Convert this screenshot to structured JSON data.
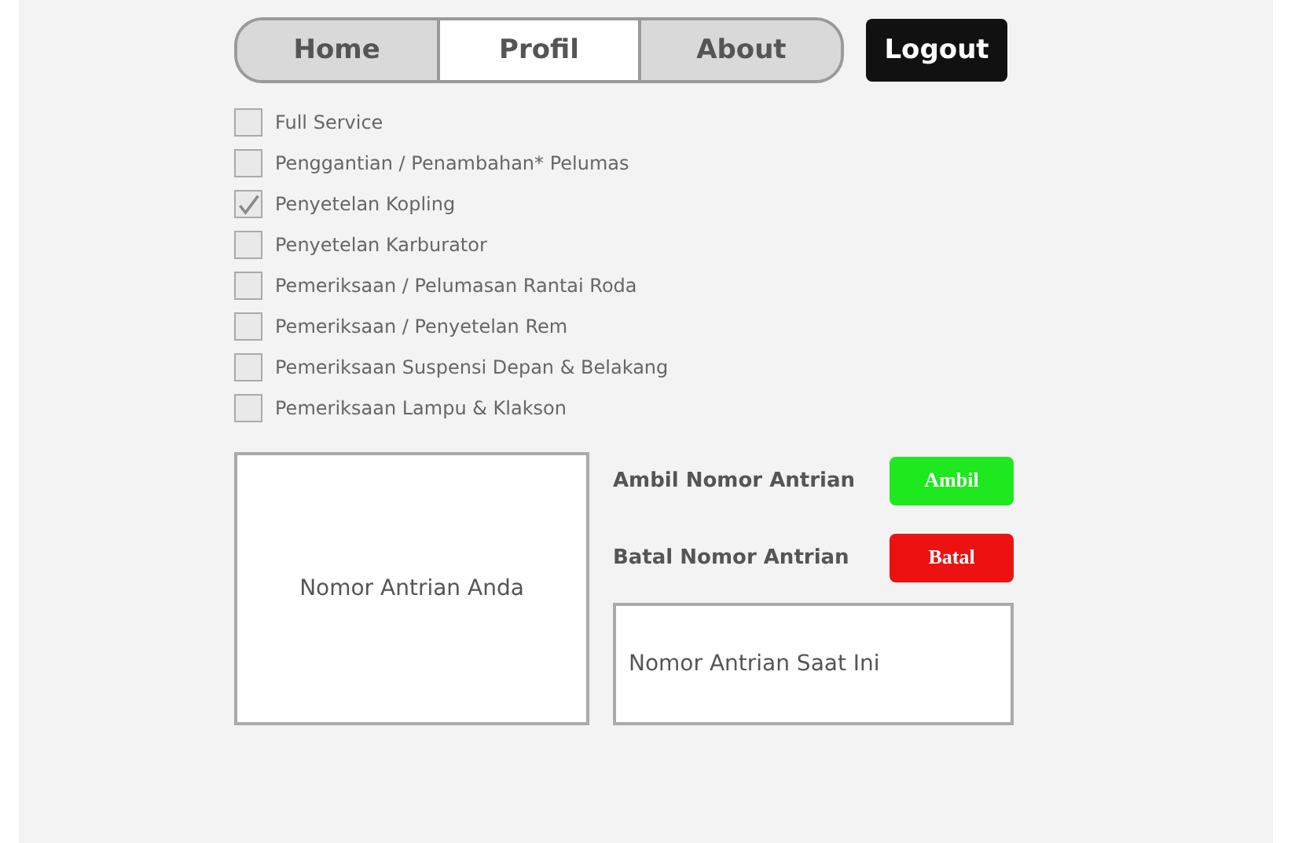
{
  "nav": {
    "tabs": [
      {
        "label": "Home",
        "selected": false
      },
      {
        "label": "Profil",
        "selected": true
      },
      {
        "label": "About",
        "selected": false
      }
    ],
    "logout": "Logout"
  },
  "services": [
    {
      "label": "Full Service",
      "checked": false
    },
    {
      "label": "Penggantian / Penambahan* Pelumas",
      "checked": false
    },
    {
      "label": "Penyetelan Kopling",
      "checked": true
    },
    {
      "label": "Penyetelan Karburator",
      "checked": false
    },
    {
      "label": "Pemeriksaan / Pelumasan Rantai Roda",
      "checked": false
    },
    {
      "label": "Pemeriksaan / Penyetelan Rem",
      "checked": false
    },
    {
      "label": "Pemeriksaan Suspensi Depan & Belakang",
      "checked": false
    },
    {
      "label": "Pemeriksaan Lampu & Klakson",
      "checked": false
    }
  ],
  "queue": {
    "your_number": "Nomor Antrian Anda",
    "actions": [
      {
        "kind": "take",
        "label": "Ambil Nomor Antrian",
        "button": "Ambil"
      },
      {
        "kind": "cancel",
        "label": "Batal Nomor Antrian",
        "button": "Batal"
      }
    ],
    "current_number": "Nomor Antrian Saat Ini"
  }
}
